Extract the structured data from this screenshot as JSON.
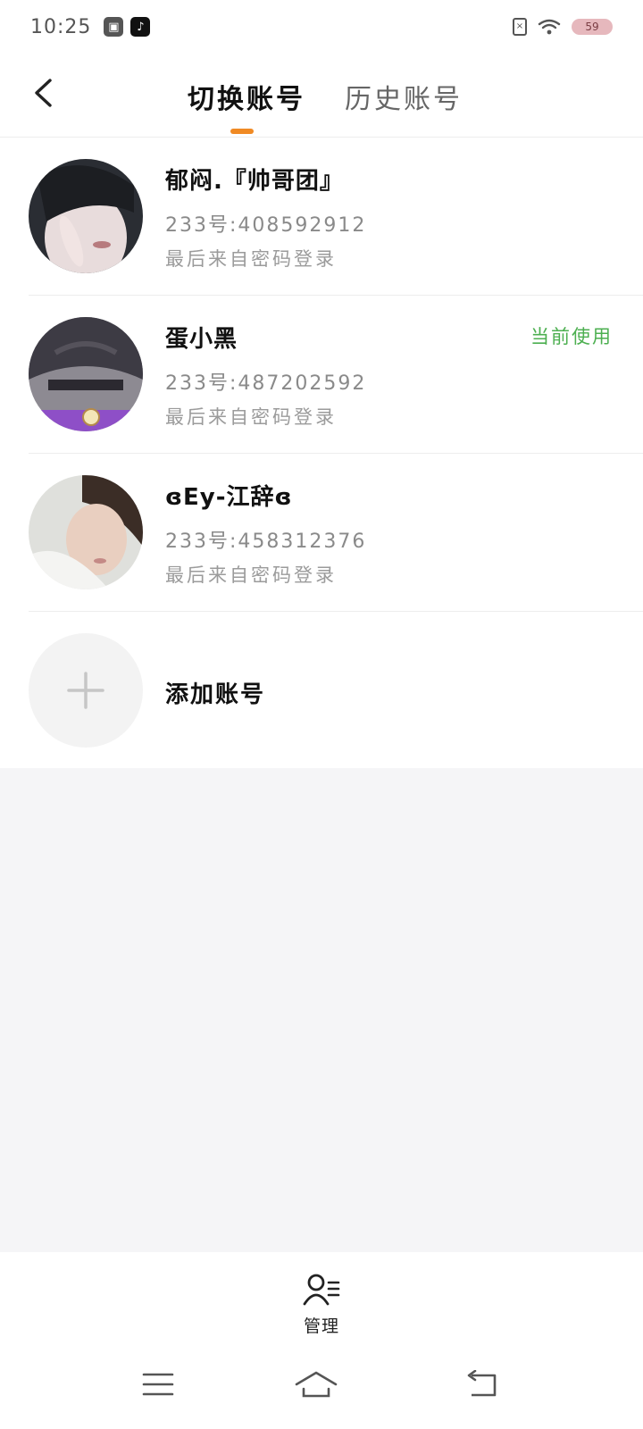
{
  "status_bar": {
    "time": "10:25",
    "battery": "59",
    "icons": [
      "screen-capture-icon",
      "tiktok-icon",
      "sim-card-icon",
      "wifi-icon",
      "battery-icon"
    ]
  },
  "header": {
    "back_icon": "chevron-left-icon",
    "tabs": [
      {
        "label": "切换账号",
        "active": true
      },
      {
        "label": "历史账号",
        "active": false
      }
    ],
    "indicator_color": "#f08a24"
  },
  "accounts": [
    {
      "name": "郁闷.『帅哥团』",
      "id": "233号:408592912",
      "login": "最后来自密码登录",
      "current": ""
    },
    {
      "name": "蛋小黑",
      "id": "233号:487202592",
      "login": "最后来自密码登录",
      "current": "当前使用"
    },
    {
      "name": "ɞEy-江辞ɞ",
      "id": "233号:458312376",
      "login": "最后来自密码登录",
      "current": ""
    }
  ],
  "add_account": {
    "label": "添加账号",
    "icon": "plus-icon"
  },
  "manage": {
    "label": "管理",
    "icon": "user-list-icon"
  },
  "system_nav": {
    "icons": [
      "menu-icon",
      "home-icon",
      "back-icon"
    ]
  },
  "colors": {
    "accent": "#f08a24",
    "current": "#4caf50",
    "background": "#f5f5f7"
  }
}
